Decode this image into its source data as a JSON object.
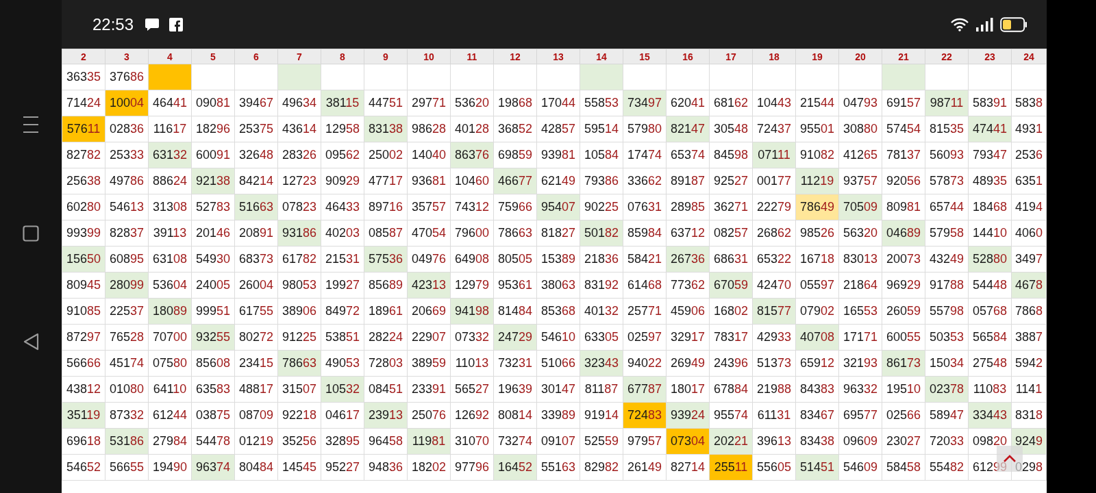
{
  "status_bar": {
    "time": "22:53"
  },
  "table": {
    "columns": [
      "2",
      "3",
      "4",
      "5",
      "6",
      "7",
      "8",
      "9",
      "10",
      "11",
      "12",
      "13",
      "14",
      "15",
      "16",
      "17",
      "18",
      "19",
      "20",
      "21",
      "22",
      "23",
      "24"
    ],
    "rows": [
      {
        "cells": [
          {
            "lead": "363",
            "tail": "35"
          },
          {
            "lead": "376",
            "tail": "86"
          },
          {
            "color": "#ffc000"
          },
          {},
          {},
          {
            "color": "#e2efda"
          },
          {},
          {},
          {},
          {},
          {},
          {},
          {
            "color": "#e2efda"
          },
          {},
          {},
          {},
          {},
          {},
          {},
          {
            "color": "#e2efda"
          },
          {},
          {},
          {}
        ]
      },
      {
        "cells": [
          {
            "lead": "714",
            "tail": "24"
          },
          {
            "lead": "100",
            "tail": "04",
            "color": "#ffc000"
          },
          {
            "lead": "464",
            "tail": "41"
          },
          {
            "lead": "090",
            "tail": "81"
          },
          {
            "lead": "394",
            "tail": "67"
          },
          {
            "lead": "496",
            "tail": "34"
          },
          {
            "lead": "381",
            "tail": "15",
            "color": "#e2efda"
          },
          {
            "lead": "447",
            "tail": "51"
          },
          {
            "lead": "297",
            "tail": "71"
          },
          {
            "lead": "536",
            "tail": "20"
          },
          {
            "lead": "198",
            "tail": "68"
          },
          {
            "lead": "170",
            "tail": "44"
          },
          {
            "lead": "558",
            "tail": "53"
          },
          {
            "lead": "734",
            "tail": "97",
            "color": "#e2efda"
          },
          {
            "lead": "620",
            "tail": "41"
          },
          {
            "lead": "681",
            "tail": "62"
          },
          {
            "lead": "104",
            "tail": "43"
          },
          {
            "lead": "215",
            "tail": "44"
          },
          {
            "lead": "047",
            "tail": "93"
          },
          {
            "lead": "691",
            "tail": "57"
          },
          {
            "lead": "987",
            "tail": "11",
            "color": "#e2efda"
          },
          {
            "lead": "583",
            "tail": "91"
          },
          {
            "lead": "583",
            "tail": "8"
          }
        ]
      },
      {
        "cells": [
          {
            "lead": "576",
            "tail": "11",
            "color": "#ffc000"
          },
          {
            "lead": "028",
            "tail": "36"
          },
          {
            "lead": "116",
            "tail": "17"
          },
          {
            "lead": "182",
            "tail": "96"
          },
          {
            "lead": "253",
            "tail": "75"
          },
          {
            "lead": "436",
            "tail": "14"
          },
          {
            "lead": "129",
            "tail": "58"
          },
          {
            "lead": "831",
            "tail": "38",
            "color": "#e2efda"
          },
          {
            "lead": "986",
            "tail": "28"
          },
          {
            "lead": "401",
            "tail": "28"
          },
          {
            "lead": "368",
            "tail": "52"
          },
          {
            "lead": "428",
            "tail": "57"
          },
          {
            "lead": "595",
            "tail": "14"
          },
          {
            "lead": "579",
            "tail": "80"
          },
          {
            "lead": "821",
            "tail": "47",
            "color": "#e2efda"
          },
          {
            "lead": "305",
            "tail": "48"
          },
          {
            "lead": "724",
            "tail": "37"
          },
          {
            "lead": "955",
            "tail": "01"
          },
          {
            "lead": "308",
            "tail": "80"
          },
          {
            "lead": "574",
            "tail": "54"
          },
          {
            "lead": "815",
            "tail": "35"
          },
          {
            "lead": "474",
            "tail": "41",
            "color": "#e2efda"
          },
          {
            "lead": "493",
            "tail": "1"
          }
        ]
      },
      {
        "cells": [
          {
            "lead": "827",
            "tail": "82"
          },
          {
            "lead": "253",
            "tail": "33"
          },
          {
            "lead": "631",
            "tail": "32",
            "color": "#e2efda"
          },
          {
            "lead": "600",
            "tail": "91"
          },
          {
            "lead": "326",
            "tail": "48"
          },
          {
            "lead": "283",
            "tail": "26"
          },
          {
            "lead": "095",
            "tail": "62"
          },
          {
            "lead": "250",
            "tail": "02"
          },
          {
            "lead": "140",
            "tail": "40"
          },
          {
            "lead": "863",
            "tail": "76",
            "color": "#e2efda"
          },
          {
            "lead": "698",
            "tail": "59"
          },
          {
            "lead": "939",
            "tail": "81"
          },
          {
            "lead": "105",
            "tail": "84"
          },
          {
            "lead": "174",
            "tail": "74"
          },
          {
            "lead": "653",
            "tail": "74"
          },
          {
            "lead": "845",
            "tail": "98"
          },
          {
            "lead": "071",
            "tail": "11",
            "color": "#e2efda"
          },
          {
            "lead": "910",
            "tail": "82"
          },
          {
            "lead": "412",
            "tail": "65"
          },
          {
            "lead": "781",
            "tail": "37"
          },
          {
            "lead": "560",
            "tail": "93"
          },
          {
            "lead": "793",
            "tail": "47"
          },
          {
            "lead": "253",
            "tail": "6"
          }
        ]
      },
      {
        "cells": [
          {
            "lead": "256",
            "tail": "38"
          },
          {
            "lead": "497",
            "tail": "86"
          },
          {
            "lead": "886",
            "tail": "24"
          },
          {
            "lead": "921",
            "tail": "38",
            "color": "#e2efda"
          },
          {
            "lead": "842",
            "tail": "14"
          },
          {
            "lead": "127",
            "tail": "23"
          },
          {
            "lead": "909",
            "tail": "29"
          },
          {
            "lead": "477",
            "tail": "17"
          },
          {
            "lead": "936",
            "tail": "81"
          },
          {
            "lead": "104",
            "tail": "60"
          },
          {
            "lead": "466",
            "tail": "77",
            "color": "#e2efda"
          },
          {
            "lead": "621",
            "tail": "49"
          },
          {
            "lead": "793",
            "tail": "86"
          },
          {
            "lead": "336",
            "tail": "62"
          },
          {
            "lead": "891",
            "tail": "87"
          },
          {
            "lead": "925",
            "tail": "27"
          },
          {
            "lead": "001",
            "tail": "77"
          },
          {
            "lead": "112",
            "tail": "19",
            "color": "#e2efda"
          },
          {
            "lead": "937",
            "tail": "57"
          },
          {
            "lead": "920",
            "tail": "56"
          },
          {
            "lead": "578",
            "tail": "73"
          },
          {
            "lead": "489",
            "tail": "35"
          },
          {
            "lead": "635",
            "tail": "1"
          }
        ]
      },
      {
        "cells": [
          {
            "lead": "602",
            "tail": "80"
          },
          {
            "lead": "546",
            "tail": "13"
          },
          {
            "lead": "313",
            "tail": "08"
          },
          {
            "lead": "527",
            "tail": "83"
          },
          {
            "lead": "516",
            "tail": "63",
            "color": "#e2efda"
          },
          {
            "lead": "078",
            "tail": "23"
          },
          {
            "lead": "464",
            "tail": "33"
          },
          {
            "lead": "897",
            "tail": "16"
          },
          {
            "lead": "357",
            "tail": "57"
          },
          {
            "lead": "743",
            "tail": "12"
          },
          {
            "lead": "759",
            "tail": "66"
          },
          {
            "lead": "954",
            "tail": "07",
            "color": "#e2efda"
          },
          {
            "lead": "902",
            "tail": "25"
          },
          {
            "lead": "076",
            "tail": "31"
          },
          {
            "lead": "289",
            "tail": "85"
          },
          {
            "lead": "362",
            "tail": "71"
          },
          {
            "lead": "222",
            "tail": "79"
          },
          {
            "lead": "786",
            "tail": "49",
            "color": "#ffe699"
          },
          {
            "lead": "705",
            "tail": "09",
            "color": "#e2efda"
          },
          {
            "lead": "809",
            "tail": "81"
          },
          {
            "lead": "657",
            "tail": "44"
          },
          {
            "lead": "184",
            "tail": "68"
          },
          {
            "lead": "419",
            "tail": "4"
          }
        ]
      },
      {
        "cells": [
          {
            "lead": "993",
            "tail": "99"
          },
          {
            "lead": "828",
            "tail": "37"
          },
          {
            "lead": "391",
            "tail": "13"
          },
          {
            "lead": "201",
            "tail": "46"
          },
          {
            "lead": "208",
            "tail": "91"
          },
          {
            "lead": "931",
            "tail": "86",
            "color": "#e2efda"
          },
          {
            "lead": "402",
            "tail": "03"
          },
          {
            "lead": "085",
            "tail": "87"
          },
          {
            "lead": "470",
            "tail": "54"
          },
          {
            "lead": "796",
            "tail": "00"
          },
          {
            "lead": "786",
            "tail": "63"
          },
          {
            "lead": "818",
            "tail": "27"
          },
          {
            "lead": "501",
            "tail": "82",
            "color": "#e2efda"
          },
          {
            "lead": "859",
            "tail": "84"
          },
          {
            "lead": "637",
            "tail": "12"
          },
          {
            "lead": "082",
            "tail": "57"
          },
          {
            "lead": "268",
            "tail": "62"
          },
          {
            "lead": "985",
            "tail": "26"
          },
          {
            "lead": "563",
            "tail": "20"
          },
          {
            "lead": "046",
            "tail": "89",
            "color": "#e2efda"
          },
          {
            "lead": "579",
            "tail": "58"
          },
          {
            "lead": "144",
            "tail": "10"
          },
          {
            "lead": "406",
            "tail": "0"
          }
        ]
      },
      {
        "cells": [
          {
            "lead": "156",
            "tail": "50",
            "color": "#e2efda"
          },
          {
            "lead": "608",
            "tail": "95"
          },
          {
            "lead": "631",
            "tail": "08"
          },
          {
            "lead": "549",
            "tail": "30"
          },
          {
            "lead": "683",
            "tail": "73"
          },
          {
            "lead": "617",
            "tail": "82"
          },
          {
            "lead": "215",
            "tail": "31"
          },
          {
            "lead": "575",
            "tail": "36",
            "color": "#e2efda"
          },
          {
            "lead": "049",
            "tail": "76"
          },
          {
            "lead": "649",
            "tail": "08"
          },
          {
            "lead": "805",
            "tail": "05"
          },
          {
            "lead": "153",
            "tail": "89"
          },
          {
            "lead": "218",
            "tail": "36"
          },
          {
            "lead": "584",
            "tail": "21"
          },
          {
            "lead": "267",
            "tail": "36",
            "color": "#e2efda"
          },
          {
            "lead": "686",
            "tail": "31"
          },
          {
            "lead": "653",
            "tail": "22"
          },
          {
            "lead": "167",
            "tail": "18"
          },
          {
            "lead": "830",
            "tail": "13"
          },
          {
            "lead": "200",
            "tail": "73"
          },
          {
            "lead": "432",
            "tail": "49"
          },
          {
            "lead": "528",
            "tail": "80",
            "color": "#e2efda"
          },
          {
            "lead": "349",
            "tail": "7"
          }
        ]
      },
      {
        "cells": [
          {
            "lead": "809",
            "tail": "45"
          },
          {
            "lead": "280",
            "tail": "99",
            "color": "#e2efda"
          },
          {
            "lead": "536",
            "tail": "04"
          },
          {
            "lead": "240",
            "tail": "05"
          },
          {
            "lead": "260",
            "tail": "04"
          },
          {
            "lead": "980",
            "tail": "53"
          },
          {
            "lead": "199",
            "tail": "27"
          },
          {
            "lead": "856",
            "tail": "89"
          },
          {
            "lead": "423",
            "tail": "13",
            "color": "#e2efda"
          },
          {
            "lead": "129",
            "tail": "79"
          },
          {
            "lead": "953",
            "tail": "61"
          },
          {
            "lead": "380",
            "tail": "63"
          },
          {
            "lead": "831",
            "tail": "92"
          },
          {
            "lead": "614",
            "tail": "68"
          },
          {
            "lead": "773",
            "tail": "62"
          },
          {
            "lead": "670",
            "tail": "59",
            "color": "#e2efda"
          },
          {
            "lead": "424",
            "tail": "70"
          },
          {
            "lead": "055",
            "tail": "97"
          },
          {
            "lead": "218",
            "tail": "64"
          },
          {
            "lead": "969",
            "tail": "29"
          },
          {
            "lead": "917",
            "tail": "88"
          },
          {
            "lead": "544",
            "tail": "48"
          },
          {
            "lead": "467",
            "tail": "8",
            "color": "#e2efda"
          }
        ]
      },
      {
        "cells": [
          {
            "lead": "910",
            "tail": "85"
          },
          {
            "lead": "225",
            "tail": "37"
          },
          {
            "lead": "180",
            "tail": "89",
            "color": "#e2efda"
          },
          {
            "lead": "999",
            "tail": "51"
          },
          {
            "lead": "617",
            "tail": "55"
          },
          {
            "lead": "389",
            "tail": "06"
          },
          {
            "lead": "849",
            "tail": "72"
          },
          {
            "lead": "189",
            "tail": "61"
          },
          {
            "lead": "206",
            "tail": "69"
          },
          {
            "lead": "941",
            "tail": "98",
            "color": "#e2efda"
          },
          {
            "lead": "814",
            "tail": "84"
          },
          {
            "lead": "853",
            "tail": "68"
          },
          {
            "lead": "401",
            "tail": "32"
          },
          {
            "lead": "257",
            "tail": "71"
          },
          {
            "lead": "459",
            "tail": "06"
          },
          {
            "lead": "168",
            "tail": "02"
          },
          {
            "lead": "815",
            "tail": "77",
            "color": "#e2efda"
          },
          {
            "lead": "079",
            "tail": "02"
          },
          {
            "lead": "165",
            "tail": "53"
          },
          {
            "lead": "260",
            "tail": "59"
          },
          {
            "lead": "557",
            "tail": "98"
          },
          {
            "lead": "057",
            "tail": "68"
          },
          {
            "lead": "786",
            "tail": "8"
          }
        ]
      },
      {
        "cells": [
          {
            "lead": "872",
            "tail": "97"
          },
          {
            "lead": "765",
            "tail": "28"
          },
          {
            "lead": "707",
            "tail": "00"
          },
          {
            "lead": "932",
            "tail": "55",
            "color": "#e2efda"
          },
          {
            "lead": "802",
            "tail": "72"
          },
          {
            "lead": "912",
            "tail": "25"
          },
          {
            "lead": "538",
            "tail": "51"
          },
          {
            "lead": "282",
            "tail": "24"
          },
          {
            "lead": "229",
            "tail": "07"
          },
          {
            "lead": "073",
            "tail": "32"
          },
          {
            "lead": "247",
            "tail": "29",
            "color": "#e2efda"
          },
          {
            "lead": "546",
            "tail": "10"
          },
          {
            "lead": "633",
            "tail": "05"
          },
          {
            "lead": "025",
            "tail": "97"
          },
          {
            "lead": "329",
            "tail": "17"
          },
          {
            "lead": "783",
            "tail": "17"
          },
          {
            "lead": "429",
            "tail": "33"
          },
          {
            "lead": "407",
            "tail": "08",
            "color": "#e2efda"
          },
          {
            "lead": "171",
            "tail": "71"
          },
          {
            "lead": "600",
            "tail": "55"
          },
          {
            "lead": "503",
            "tail": "53"
          },
          {
            "lead": "565",
            "tail": "84"
          },
          {
            "lead": "388",
            "tail": "7"
          }
        ]
      },
      {
        "cells": [
          {
            "lead": "566",
            "tail": "66"
          },
          {
            "lead": "451",
            "tail": "74"
          },
          {
            "lead": "075",
            "tail": "80"
          },
          {
            "lead": "856",
            "tail": "08"
          },
          {
            "lead": "234",
            "tail": "15"
          },
          {
            "lead": "786",
            "tail": "63",
            "color": "#e2efda"
          },
          {
            "lead": "490",
            "tail": "53"
          },
          {
            "lead": "728",
            "tail": "03"
          },
          {
            "lead": "389",
            "tail": "59"
          },
          {
            "lead": "110",
            "tail": "13"
          },
          {
            "lead": "732",
            "tail": "31"
          },
          {
            "lead": "510",
            "tail": "66"
          },
          {
            "lead": "323",
            "tail": "43",
            "color": "#e2efda"
          },
          {
            "lead": "940",
            "tail": "22"
          },
          {
            "lead": "269",
            "tail": "49"
          },
          {
            "lead": "243",
            "tail": "96"
          },
          {
            "lead": "513",
            "tail": "73"
          },
          {
            "lead": "659",
            "tail": "12"
          },
          {
            "lead": "321",
            "tail": "93"
          },
          {
            "lead": "861",
            "tail": "73",
            "color": "#e2efda"
          },
          {
            "lead": "150",
            "tail": "34"
          },
          {
            "lead": "275",
            "tail": "48"
          },
          {
            "lead": "594",
            "tail": "2"
          }
        ]
      },
      {
        "cells": [
          {
            "lead": "438",
            "tail": "12"
          },
          {
            "lead": "010",
            "tail": "80"
          },
          {
            "lead": "641",
            "tail": "10"
          },
          {
            "lead": "635",
            "tail": "83"
          },
          {
            "lead": "488",
            "tail": "17"
          },
          {
            "lead": "315",
            "tail": "07"
          },
          {
            "lead": "105",
            "tail": "32",
            "color": "#e2efda"
          },
          {
            "lead": "084",
            "tail": "51"
          },
          {
            "lead": "233",
            "tail": "91"
          },
          {
            "lead": "565",
            "tail": "27"
          },
          {
            "lead": "196",
            "tail": "39"
          },
          {
            "lead": "301",
            "tail": "47"
          },
          {
            "lead": "811",
            "tail": "87"
          },
          {
            "lead": "677",
            "tail": "87",
            "color": "#e2efda"
          },
          {
            "lead": "180",
            "tail": "17"
          },
          {
            "lead": "678",
            "tail": "84"
          },
          {
            "lead": "219",
            "tail": "88"
          },
          {
            "lead": "843",
            "tail": "83"
          },
          {
            "lead": "963",
            "tail": "32"
          },
          {
            "lead": "195",
            "tail": "10"
          },
          {
            "lead": "023",
            "tail": "78",
            "color": "#e2efda"
          },
          {
            "lead": "110",
            "tail": "83"
          },
          {
            "lead": "114",
            "tail": "1"
          }
        ]
      },
      {
        "cells": [
          {
            "lead": "351",
            "tail": "19",
            "color": "#e2efda"
          },
          {
            "lead": "873",
            "tail": "32"
          },
          {
            "lead": "612",
            "tail": "44"
          },
          {
            "lead": "038",
            "tail": "75"
          },
          {
            "lead": "087",
            "tail": "09"
          },
          {
            "lead": "922",
            "tail": "18"
          },
          {
            "lead": "046",
            "tail": "17"
          },
          {
            "lead": "239",
            "tail": "13",
            "color": "#e2efda"
          },
          {
            "lead": "250",
            "tail": "76"
          },
          {
            "lead": "126",
            "tail": "92"
          },
          {
            "lead": "808",
            "tail": "14"
          },
          {
            "lead": "339",
            "tail": "89"
          },
          {
            "lead": "919",
            "tail": "14"
          },
          {
            "lead": "724",
            "tail": "83",
            "color": "#ffc000"
          },
          {
            "lead": "939",
            "tail": "24",
            "color": "#e2efda"
          },
          {
            "lead": "955",
            "tail": "74"
          },
          {
            "lead": "611",
            "tail": "31"
          },
          {
            "lead": "834",
            "tail": "67"
          },
          {
            "lead": "695",
            "tail": "77"
          },
          {
            "lead": "025",
            "tail": "66"
          },
          {
            "lead": "589",
            "tail": "47"
          },
          {
            "lead": "334",
            "tail": "43",
            "color": "#e2efda"
          },
          {
            "lead": "831",
            "tail": "8"
          }
        ]
      },
      {
        "cells": [
          {
            "lead": "696",
            "tail": "18"
          },
          {
            "lead": "531",
            "tail": "86",
            "color": "#e2efda"
          },
          {
            "lead": "279",
            "tail": "84"
          },
          {
            "lead": "544",
            "tail": "78"
          },
          {
            "lead": "012",
            "tail": "19"
          },
          {
            "lead": "352",
            "tail": "56"
          },
          {
            "lead": "328",
            "tail": "95"
          },
          {
            "lead": "964",
            "tail": "58"
          },
          {
            "lead": "119",
            "tail": "81",
            "color": "#e2efda"
          },
          {
            "lead": "310",
            "tail": "70"
          },
          {
            "lead": "732",
            "tail": "74"
          },
          {
            "lead": "091",
            "tail": "07"
          },
          {
            "lead": "525",
            "tail": "59"
          },
          {
            "lead": "979",
            "tail": "57"
          },
          {
            "lead": "073",
            "tail": "04",
            "color": "#ffc000"
          },
          {
            "lead": "202",
            "tail": "21",
            "color": "#e2efda"
          },
          {
            "lead": "396",
            "tail": "13"
          },
          {
            "lead": "834",
            "tail": "38"
          },
          {
            "lead": "096",
            "tail": "09"
          },
          {
            "lead": "230",
            "tail": "27"
          },
          {
            "lead": "720",
            "tail": "33"
          },
          {
            "lead": "098",
            "tail": "20"
          },
          {
            "lead": "924",
            "tail": "9",
            "color": "#e2efda"
          }
        ]
      },
      {
        "cells": [
          {
            "lead": "546",
            "tail": "52"
          },
          {
            "lead": "566",
            "tail": "55"
          },
          {
            "lead": "194",
            "tail": "90"
          },
          {
            "lead": "963",
            "tail": "74",
            "color": "#e2efda"
          },
          {
            "lead": "804",
            "tail": "84"
          },
          {
            "lead": "145",
            "tail": "45"
          },
          {
            "lead": "952",
            "tail": "27"
          },
          {
            "lead": "948",
            "tail": "36"
          },
          {
            "lead": "182",
            "tail": "02"
          },
          {
            "lead": "977",
            "tail": "96"
          },
          {
            "lead": "164",
            "tail": "52",
            "color": "#e2efda"
          },
          {
            "lead": "551",
            "tail": "63"
          },
          {
            "lead": "829",
            "tail": "82"
          },
          {
            "lead": "261",
            "tail": "49"
          },
          {
            "lead": "827",
            "tail": "14"
          },
          {
            "lead": "255",
            "tail": "11",
            "color": "#ffc000"
          },
          {
            "lead": "556",
            "tail": "05"
          },
          {
            "lead": "514",
            "tail": "51",
            "color": "#e2efda"
          },
          {
            "lead": "546",
            "tail": "09"
          },
          {
            "lead": "584",
            "tail": "58"
          },
          {
            "lead": "554",
            "tail": "82"
          },
          {
            "lead": "612",
            "tail": "99"
          },
          {
            "lead": "029",
            "tail": "8"
          }
        ]
      }
    ]
  }
}
